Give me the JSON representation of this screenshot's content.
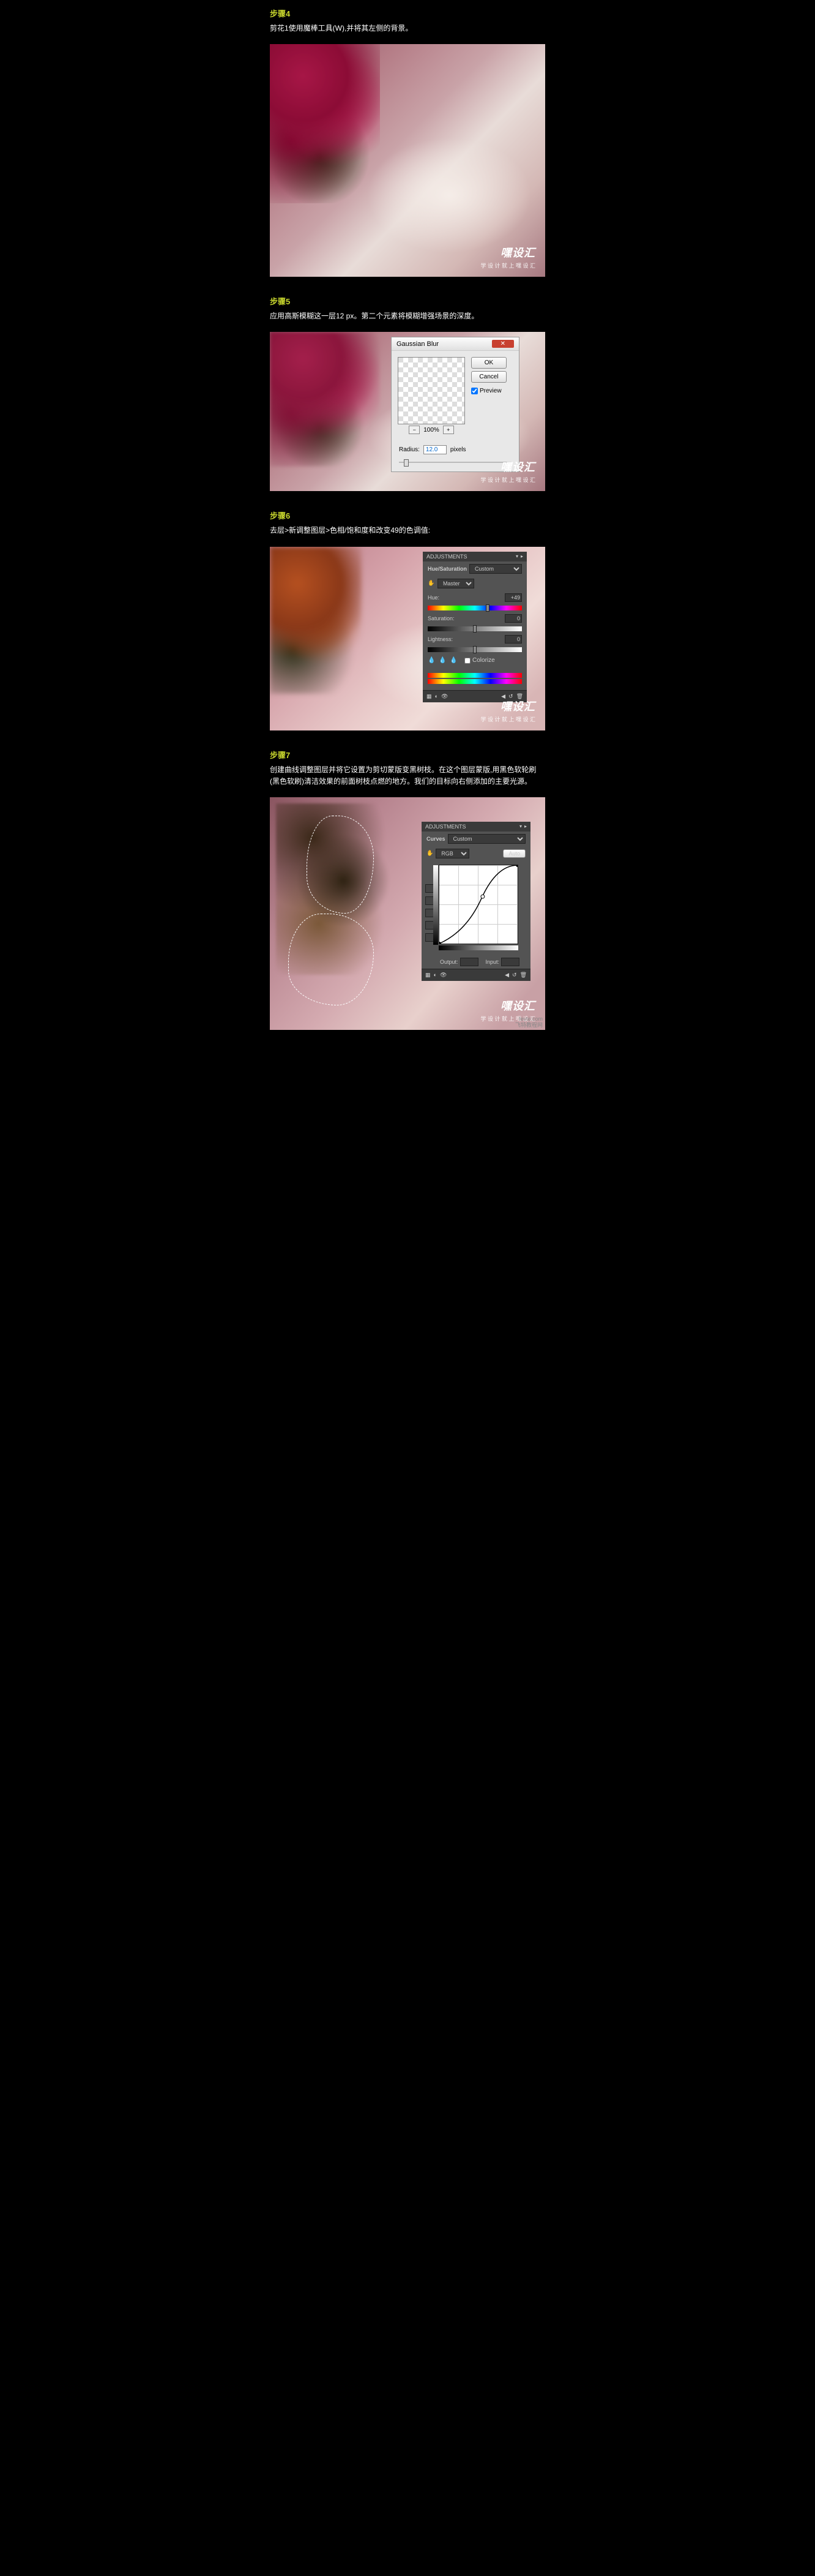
{
  "watermark": {
    "logo": "嘿设汇",
    "tagline": "学 设 计 就 上 嘿 设 汇"
  },
  "bottom_wm": {
    "line1": "fevte.com",
    "line2": "飞特教程网"
  },
  "step4": {
    "title": "步骤4",
    "desc": "剪花1使用魔棒工具(W),并将其左侧的背景。"
  },
  "step5": {
    "title": "步骤5",
    "desc": "应用高斯模糊这一层12 px。第二个元素将模糊增强场景的深度。",
    "dialog": {
      "title": "Gaussian Blur",
      "ok": "OK",
      "cancel": "Cancel",
      "preview": "Preview",
      "zoom": "100%",
      "radius_label": "Radius:",
      "radius_value": "12.0",
      "radius_unit": "pixels"
    }
  },
  "step6": {
    "title": "步骤6",
    "desc": "去层>新调整图层>色相/饱和度和改变49的色调值:",
    "panel": {
      "header": "ADJUSTMENTS",
      "mode": "Hue/Saturation",
      "preset": "Custom",
      "channel": "Master",
      "hue_label": "Hue:",
      "hue_val": "+49",
      "sat_label": "Saturation:",
      "sat_val": "0",
      "light_label": "Lightness:",
      "light_val": "0",
      "colorize": "Colorize"
    }
  },
  "step7": {
    "title": "步骤7",
    "desc": "创建曲线调整图层并将它设置为剪切蒙版变黑树枝。在这个图层蒙版,用黑色软轮刷(黑色软刷)清洁效果的前面树枝点燃的地方。我们的目标向右侧添加的主要光源。",
    "panel": {
      "header": "ADJUSTMENTS",
      "mode": "Curves",
      "preset": "Custom",
      "channel": "RGB",
      "auto": "Auto",
      "output": "Output:",
      "input": "Input:"
    }
  }
}
